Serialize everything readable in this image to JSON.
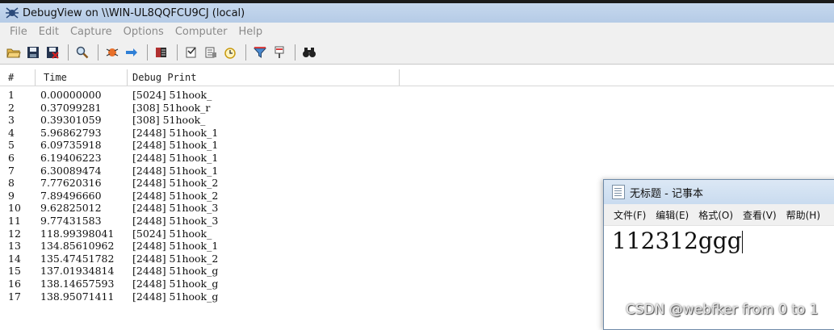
{
  "window": {
    "title": "DebugView on \\\\WIN-UL8QQFCU9CJ (local)"
  },
  "menu": [
    "File",
    "Edit",
    "Capture",
    "Options",
    "Computer",
    "Help"
  ],
  "toolbar_icons": [
    "open-icon",
    "save-icon",
    "clear-icon",
    "find-icon",
    "capture-icon",
    "autoscroll-icon",
    "history-icon",
    "options-icon",
    "timestamp-icon",
    "clock-icon",
    "filter-icon",
    "highlight-icon",
    "search-binoculars-icon"
  ],
  "columns": {
    "num": "#",
    "time": "Time",
    "debug": "Debug Print"
  },
  "rows": [
    {
      "num": "1",
      "time": "0.00000000",
      "msg": "[5024] 51hook_"
    },
    {
      "num": "2",
      "time": "0.37099281",
      "msg": "[308] 51hook_r"
    },
    {
      "num": "3",
      "time": "0.39301059",
      "msg": "[308] 51hook_"
    },
    {
      "num": "4",
      "time": "5.96862793",
      "msg": "[2448] 51hook_1"
    },
    {
      "num": "5",
      "time": "6.09735918",
      "msg": "[2448] 51hook_1"
    },
    {
      "num": "6",
      "time": "6.19406223",
      "msg": "[2448] 51hook_1"
    },
    {
      "num": "7",
      "time": "6.30089474",
      "msg": "[2448] 51hook_1"
    },
    {
      "num": "8",
      "time": "7.77620316",
      "msg": "[2448] 51hook_2"
    },
    {
      "num": "9",
      "time": "7.89496660",
      "msg": "[2448] 51hook_2"
    },
    {
      "num": "10",
      "time": "9.62825012",
      "msg": "[2448] 51hook_3"
    },
    {
      "num": "11",
      "time": "9.77431583",
      "msg": "[2448] 51hook_3"
    },
    {
      "num": "12",
      "time": "118.99398041",
      "msg": "[5024] 51hook_"
    },
    {
      "num": "13",
      "time": "134.85610962",
      "msg": "[2448] 51hook_1"
    },
    {
      "num": "14",
      "time": "135.47451782",
      "msg": "[2448] 51hook_2"
    },
    {
      "num": "15",
      "time": "137.01934814",
      "msg": "[2448] 51hook_g"
    },
    {
      "num": "16",
      "time": "138.14657593",
      "msg": "[2448] 51hook_g"
    },
    {
      "num": "17",
      "time": "138.95071411",
      "msg": "[2448] 51hook_g"
    }
  ],
  "notepad": {
    "title": "无标题 - 记事本",
    "menu": [
      "文件(F)",
      "编辑(E)",
      "格式(O)",
      "查看(V)",
      "帮助(H)"
    ],
    "content": "112312ggg"
  },
  "watermark": "CSDN @webfker from 0 to 1"
}
